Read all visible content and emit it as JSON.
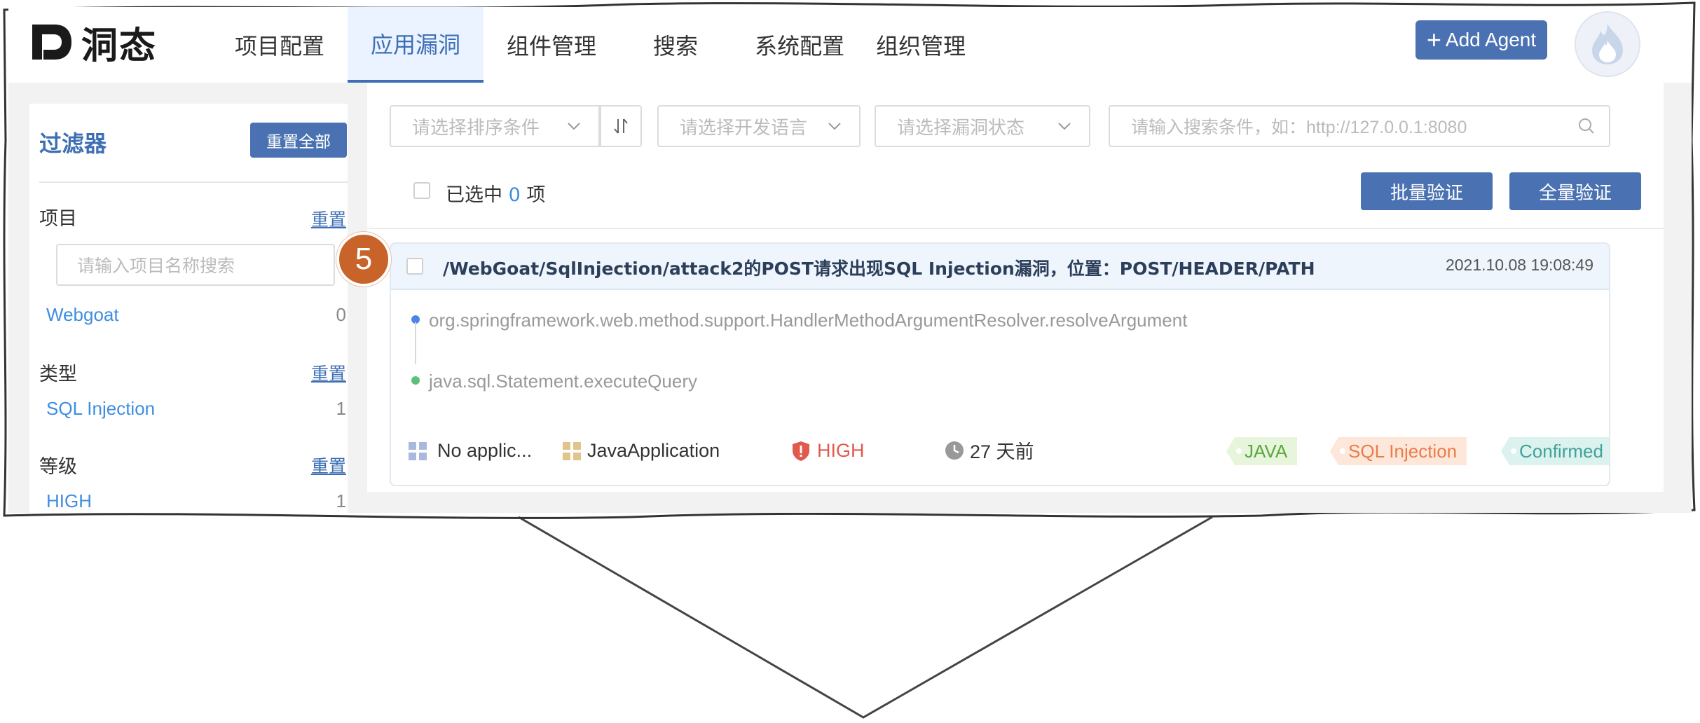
{
  "app": {
    "logo_text": "洞态",
    "nav": [
      {
        "label": "项目配置",
        "active": false
      },
      {
        "label": "应用漏洞",
        "active": true
      },
      {
        "label": "组件管理",
        "active": false
      },
      {
        "label": "搜索",
        "active": false
      },
      {
        "label": "系统配置",
        "active": false
      },
      {
        "label": "组织管理",
        "active": false
      }
    ],
    "add_agent_label": "Add Agent",
    "accent_color": "#4a72b2"
  },
  "sidebar": {
    "title": "过滤器",
    "reset_all_label": "重置全部",
    "sections": [
      {
        "heading": "项目",
        "reset_label": "重置",
        "items": [
          {
            "label": "Webgoat",
            "count": "0"
          }
        ]
      },
      {
        "heading": "类型",
        "reset_label": "重置",
        "items": [
          {
            "label": "SQL Injection",
            "count": "1"
          }
        ]
      },
      {
        "heading": "等级",
        "reset_label": "重置",
        "items": [
          {
            "label": "HIGH",
            "count": "1"
          }
        ]
      }
    ],
    "project_search_placeholder": "请输入项目名称搜索"
  },
  "toolbar": {
    "sort_placeholder": "请选择排序条件",
    "language_placeholder": "请选择开发语言",
    "status_placeholder": "请选择漏洞状态",
    "search_placeholder": "请输入搜索条件，如：http://127.0.0.1:8080",
    "selected_prefix": "已选中",
    "selected_count": "0",
    "selected_suffix": "项",
    "batch_verify_label": "批量验证",
    "full_verify_label": "全量验证"
  },
  "vulnerability": {
    "title": "/WebGoat/SqlInjection/attack2的POST请求出现SQL Injection漏洞，位置：POST/HEADER/PATH",
    "time": "2021.10.08 19:08:49",
    "trace": [
      {
        "method": "org.springframework.web.method.support.HandlerMethodArgumentResolver.resolveArgument",
        "color": "#4a86e8"
      },
      {
        "method": "java.sql.Statement.executeQuery",
        "color": "#5cbf7a"
      }
    ],
    "application": "No applic...",
    "app_type": "JavaApplication",
    "level": "HIGH",
    "age": "27 天前",
    "tags": [
      {
        "label": "JAVA",
        "kind": "java"
      },
      {
        "label": "SQL Injection",
        "kind": "sqli"
      },
      {
        "label": "Confirmed",
        "kind": "conf"
      }
    ]
  },
  "callout": {
    "step_number": "5"
  }
}
